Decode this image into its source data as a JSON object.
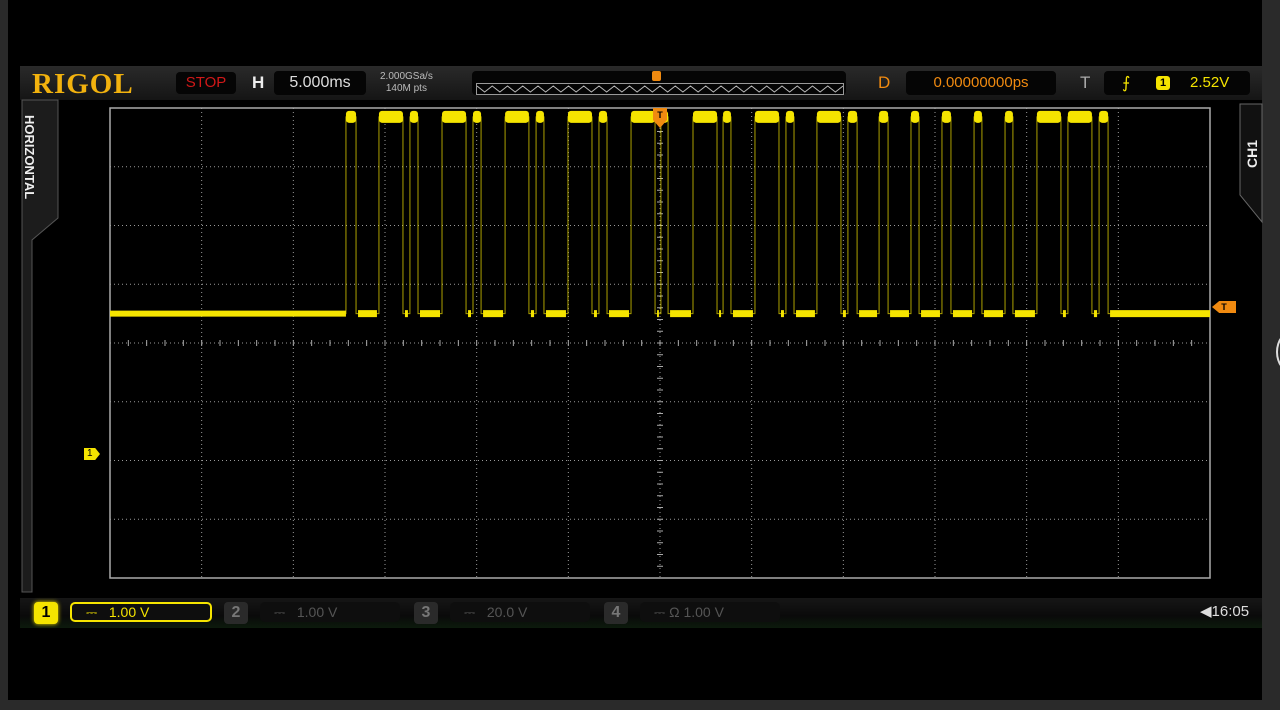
{
  "header": {
    "logo": "RIGOL",
    "run_state": "STOP",
    "horizontal_label": "H",
    "timebase": "5.000ms",
    "sample_rate": "2.000GSa/s",
    "memory_depth": "140M pts",
    "delay_label": "D",
    "delay_value": "0.00000000ps",
    "trigger_label": "T",
    "trigger_slope": "rising-edge-icon",
    "trigger_source": "1",
    "trigger_level": "2.52V"
  },
  "side_tabs": {
    "left": "HORIZONTAL",
    "right": "CH1"
  },
  "channels": [
    {
      "num": "1",
      "coupling": "DC",
      "scale": "1.00 V",
      "active": true,
      "color": "#f5e400"
    },
    {
      "num": "2",
      "coupling": "DC",
      "scale": "1.00 V",
      "active": false
    },
    {
      "num": "3",
      "coupling": "DC",
      "scale": "20.0 V",
      "active": false
    },
    {
      "num": "4",
      "coupling": "DC",
      "impedance": "Ω",
      "scale": "1.00 V",
      "active": false
    }
  ],
  "status": {
    "sound_icon": "speaker-icon",
    "time": "16:05"
  },
  "markers": {
    "ch1_ground": "1",
    "trigger_position": "T",
    "trigger_level": "T"
  },
  "colors": {
    "ch1": "#f5e400",
    "trigger": "#f08a10",
    "grid": "#9a9a9a"
  },
  "chart_data": {
    "type": "line",
    "title": "",
    "x_units": "ms",
    "y_units": "V",
    "xlim": [
      -30,
      30
    ],
    "ylim": [
      -4.5,
      3.5
    ],
    "x_divisions": 12,
    "y_divisions": 8,
    "grid": true,
    "low_level": 0,
    "high_level": 3.35,
    "trigger_level": 2.52,
    "high_intervals": [
      [
        -17.13,
        -16.58
      ],
      [
        -15.33,
        -14.02
      ],
      [
        -13.64,
        -13.2
      ],
      [
        -11.89,
        -10.58
      ],
      [
        -10.2,
        -9.76
      ],
      [
        -8.45,
        -7.15
      ],
      [
        -6.76,
        -6.33
      ],
      [
        -5.02,
        -3.71
      ],
      [
        -3.33,
        -2.89
      ],
      [
        -1.58,
        -0.27
      ],
      [
        0.05,
        0.44
      ],
      [
        1.8,
        3.11
      ],
      [
        3.44,
        3.87
      ],
      [
        5.18,
        6.49
      ],
      [
        6.87,
        7.31
      ],
      [
        8.56,
        9.87
      ],
      [
        10.25,
        10.75
      ],
      [
        11.95,
        12.44
      ],
      [
        13.69,
        14.13
      ],
      [
        15.38,
        15.87
      ],
      [
        17.13,
        17.56
      ],
      [
        18.82,
        19.25
      ],
      [
        20.56,
        21.87
      ],
      [
        22.25,
        23.56
      ],
      [
        23.95,
        24.44
      ]
    ]
  }
}
